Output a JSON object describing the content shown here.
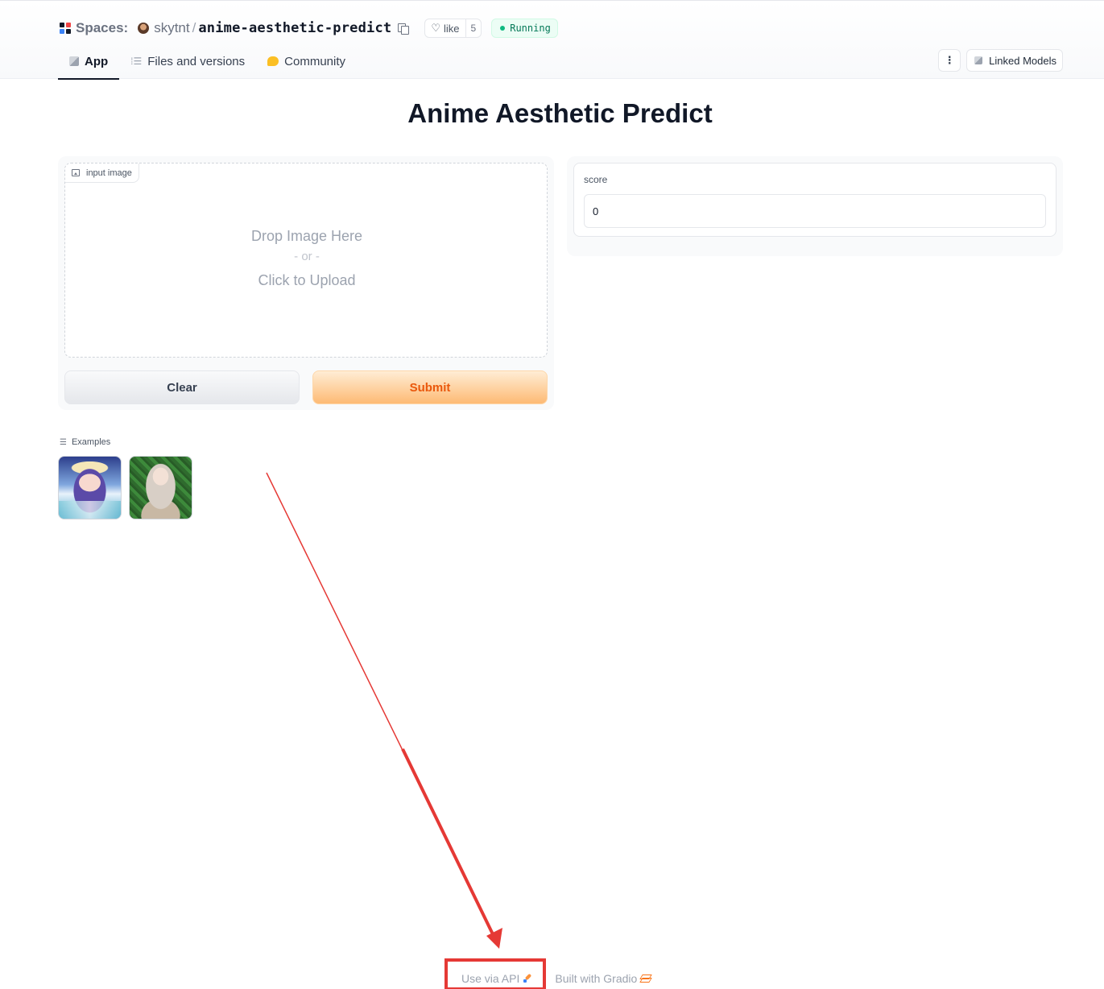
{
  "header": {
    "spaces_label": "Spaces:",
    "owner": "skytnt",
    "separator": "/",
    "repo_name": "anime-aesthetic-predict",
    "like_label": "like",
    "like_count": "5",
    "status": "Running",
    "status_color": "#10b981",
    "tabs": [
      {
        "label": "App",
        "icon": "cube-icon",
        "active": true
      },
      {
        "label": "Files and versions",
        "icon": "files-icon",
        "active": false
      },
      {
        "label": "Community",
        "icon": "community-icon",
        "active": false
      }
    ],
    "more_icon": "⋮",
    "linked_models_label": "Linked Models"
  },
  "app": {
    "title": "Anime Aesthetic Predict",
    "input_image": {
      "label": "input image",
      "drop_text": "Drop Image Here",
      "or_text": "- or -",
      "click_text": "Click to Upload"
    },
    "buttons": {
      "clear": "Clear",
      "submit": "Submit"
    },
    "output": {
      "label": "score",
      "value": "0"
    },
    "examples": {
      "label": "Examples",
      "items": [
        {
          "icon": "anime-girl-sky-thumbnail"
        },
        {
          "icon": "anime-girl-forest-thumbnail"
        }
      ]
    }
  },
  "footer": {
    "use_api": "Use via API",
    "built_with": "Built with Gradio"
  },
  "colors": {
    "accent": "#ea580c",
    "annotation": "#e53935"
  }
}
